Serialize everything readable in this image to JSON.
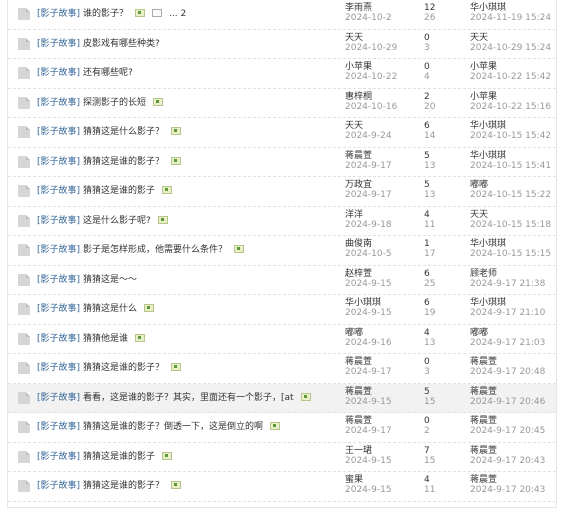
{
  "threads": [
    {
      "category": "[影子故事]",
      "title": "谁的影子？",
      "has_image": true,
      "pages": "... 2",
      "author": "李雨熹",
      "date": "2024-10-2",
      "replies": "12",
      "views": "26",
      "last_poster": "华小琪琪",
      "last_time": "2024-11-19 15:24",
      "highlight": false
    },
    {
      "category": "[影子故事]",
      "title": "皮影戏有哪些种类?",
      "has_image": false,
      "author": "天天",
      "date": "2024-10-29",
      "replies": "0",
      "views": "3",
      "last_poster": "天天",
      "last_time": "2024-10-29 15:24",
      "highlight": false
    },
    {
      "category": "[影子故事]",
      "title": "还有哪些呢?",
      "has_image": false,
      "author": "小苹果",
      "date": "2024-10-22",
      "replies": "0",
      "views": "4",
      "last_poster": "小苹果",
      "last_time": "2024-10-22 15:42",
      "highlight": false
    },
    {
      "category": "[影子故事]",
      "title": "探测影子的长短",
      "has_image": true,
      "author": "惠梓桐",
      "date": "2024-10-16",
      "replies": "2",
      "views": "20",
      "last_poster": "小苹果",
      "last_time": "2024-10-22 15:16",
      "highlight": false
    },
    {
      "category": "[影子故事]",
      "title": "猜猜这是什么影子？",
      "has_image": true,
      "author": "天天",
      "date": "2024-9-24",
      "replies": "6",
      "views": "14",
      "last_poster": "华小琪琪",
      "last_time": "2024-10-15 15:42",
      "highlight": false
    },
    {
      "category": "[影子故事]",
      "title": "猜猜这是谁的影子？",
      "has_image": true,
      "author": "蒋晨萱",
      "date": "2024-9-17",
      "replies": "5",
      "views": "13",
      "last_poster": "华小琪琪",
      "last_time": "2024-10-15 15:41",
      "highlight": false
    },
    {
      "category": "[影子故事]",
      "title": "猜猜这是谁的影子",
      "has_image": true,
      "author": "万政宜",
      "date": "2024-9-17",
      "replies": "5",
      "views": "13",
      "last_poster": "嘟嘟",
      "last_time": "2024-10-15 15:22",
      "highlight": false
    },
    {
      "category": "[影子故事]",
      "title": "这是什么影子呢?",
      "has_image": true,
      "author": "洋洋",
      "date": "2024-9-18",
      "replies": "4",
      "views": "11",
      "last_poster": "天天",
      "last_time": "2024-10-15 15:18",
      "highlight": false
    },
    {
      "category": "[影子故事]",
      "title": "影子是怎样形成，他需要什么条件？",
      "has_image": true,
      "author": "曲俊南",
      "date": "2024-10-5",
      "replies": "1",
      "views": "17",
      "last_poster": "华小琪琪",
      "last_time": "2024-10-15 15:15",
      "highlight": false
    },
    {
      "category": "[影子故事]",
      "title": "猜猜这是～～",
      "has_image": false,
      "author": "赵梓萱",
      "date": "2024-9-15",
      "replies": "6",
      "views": "25",
      "last_poster": "顾老师",
      "last_time": "2024-9-17 21:38",
      "highlight": false
    },
    {
      "category": "[影子故事]",
      "title": "猜猜这是什么",
      "has_image": true,
      "author": "华小琪琪",
      "date": "2024-9-15",
      "replies": "6",
      "views": "19",
      "last_poster": "华小琪琪",
      "last_time": "2024-9-17 21:10",
      "highlight": false
    },
    {
      "category": "[影子故事]",
      "title": "猜猜他是谁",
      "has_image": true,
      "author": "嘟嘟",
      "date": "2024-9-16",
      "replies": "4",
      "views": "13",
      "last_poster": "嘟嘟",
      "last_time": "2024-9-17 21:03",
      "highlight": false
    },
    {
      "category": "[影子故事]",
      "title": "猜猜这是谁的影子？",
      "has_image": true,
      "author": "蒋晨萱",
      "date": "2024-9-17",
      "replies": "0",
      "views": "3",
      "last_poster": "蒋晨萱",
      "last_time": "2024-9-17 20:48",
      "highlight": false
    },
    {
      "category": "[影子故事]",
      "title": "看看，这是谁的影子？其实，里面还有一个影子，[at",
      "has_image": true,
      "author": "蒋晨萱",
      "date": "2024-9-15",
      "replies": "5",
      "views": "15",
      "last_poster": "蒋晨萱",
      "last_time": "2024-9-17 20:46",
      "highlight": true
    },
    {
      "category": "[影子故事]",
      "title": "猜猜这是谁的影子？倒透一下，这是倒立的啊",
      "has_image": true,
      "author": "蒋晨萱",
      "date": "2024-9-17",
      "replies": "0",
      "views": "2",
      "last_poster": "蒋晨萱",
      "last_time": "2024-9-17 20:45",
      "highlight": false
    },
    {
      "category": "[影子故事]",
      "title": "猜猜这是谁的影子",
      "has_image": true,
      "author": "王一珺",
      "date": "2024-9-15",
      "replies": "7",
      "views": "15",
      "last_poster": "蒋晨萱",
      "last_time": "2024-9-17 20:43",
      "highlight": false
    },
    {
      "category": "[影子故事]",
      "title": "猜猜这是谁的影子？",
      "has_image": true,
      "author": "蜜果",
      "date": "2024-9-15",
      "replies": "4",
      "views": "11",
      "last_poster": "蒋晨萱",
      "last_time": "2024-9-17 20:43",
      "highlight": false
    }
  ]
}
